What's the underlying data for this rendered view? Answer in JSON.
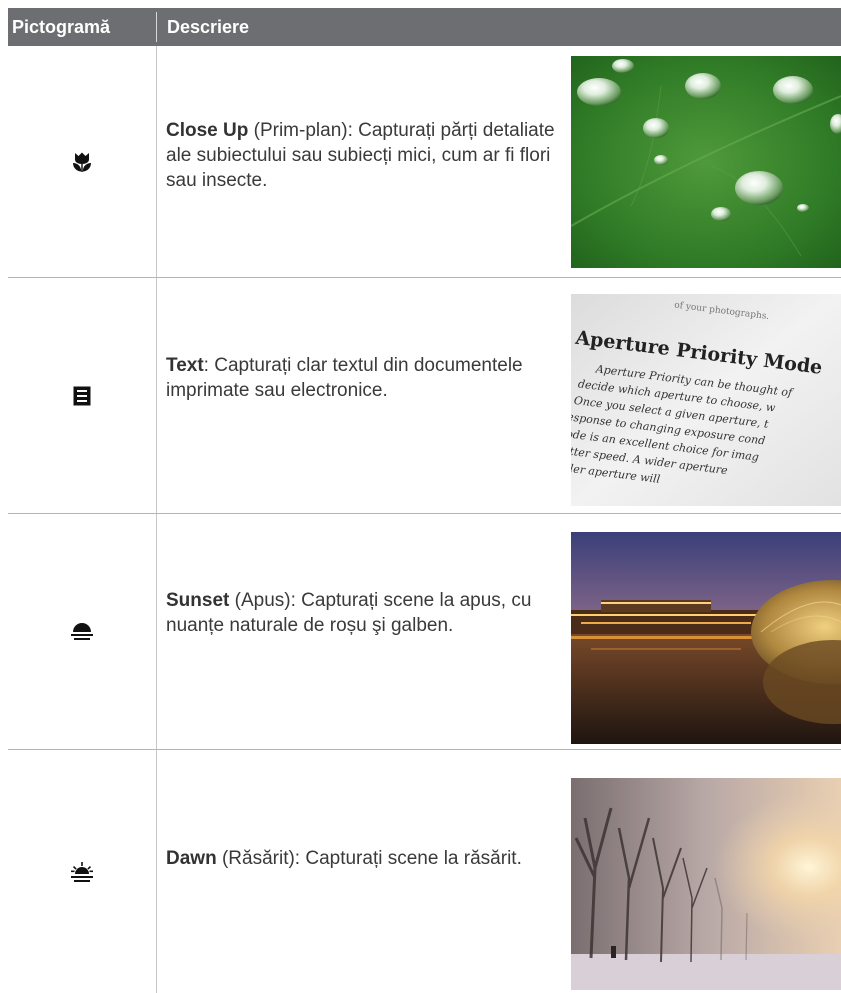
{
  "header": {
    "col_icon": "Pictogramă",
    "col_description": "Descriere"
  },
  "rows": [
    {
      "icon": "macro-flower-icon",
      "title": "Close Up",
      "text": " (Prim-plan): Capturați părți detaliate ale subiectului sau subiecți mici, cum ar fi flori sau insecte.",
      "image": "water-droplets-on-leaf-photo"
    },
    {
      "icon": "document-text-icon",
      "title": "Text",
      "text": ": Capturați clar textul din documentele imprimate sau electronice.",
      "image": "printed-text-page-photo",
      "photo_text": [
        "of your photographs.",
        "Aperture Priority Mode",
        "Aperture Priority can be thought of",
        "decide which aperture to choose, w",
        "Once you select a given aperture, t",
        "response to changing exposure cond",
        "mode is an excellent choice for imag",
        "shutter speed. A wider aperture",
        "smaller aperture will"
      ]
    },
    {
      "icon": "sunset-icon",
      "title": "Sunset",
      "text": " (Apus): Capturați scene la apus, cu nuanțe naturale de roșu şi galben.",
      "image": "sunset-building-reflection-photo"
    },
    {
      "icon": "dawn-icon",
      "title": "Dawn",
      "text": " (Răsărit): Capturați scene la răsărit.",
      "image": "misty-dawn-trees-photo"
    }
  ]
}
